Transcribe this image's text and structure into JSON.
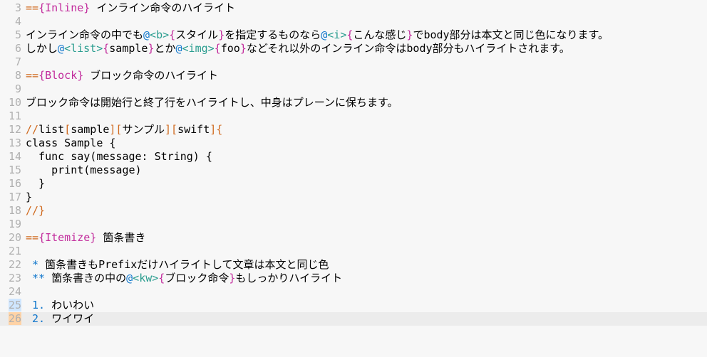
{
  "lines": {
    "3": {
      "n": "3",
      "seg": [
        [
          "or",
          "=="
        ],
        [
          "mag",
          "{Inline}"
        ],
        [
          "",
          " インライン命令のハイライト"
        ]
      ]
    },
    "4": {
      "n": "4",
      "seg": [
        [
          "",
          ""
        ]
      ]
    },
    "5": {
      "n": "5",
      "seg": [
        [
          "",
          "インライン命令の中でも"
        ],
        [
          "bl",
          "@"
        ],
        [
          "tag",
          "<b>"
        ],
        [
          "mag",
          "{"
        ],
        [
          "",
          "スタイル"
        ],
        [
          "mag",
          "}"
        ],
        [
          "",
          "を指定するものなら"
        ],
        [
          "bl",
          "@"
        ],
        [
          "tag",
          "<i>"
        ],
        [
          "mag",
          "{"
        ],
        [
          "",
          "こんな感じ"
        ],
        [
          "mag",
          "}"
        ],
        [
          "",
          "でbody部分は本文と同じ色になります。"
        ]
      ]
    },
    "6": {
      "n": "6",
      "seg": [
        [
          "",
          "しかし"
        ],
        [
          "bl",
          "@"
        ],
        [
          "tag",
          "<list>"
        ],
        [
          "mag",
          "{"
        ],
        [
          "",
          "sample"
        ],
        [
          "mag",
          "}"
        ],
        [
          "",
          "とか"
        ],
        [
          "bl",
          "@"
        ],
        [
          "tag",
          "<img>"
        ],
        [
          "mag",
          "{"
        ],
        [
          "",
          "foo"
        ],
        [
          "mag",
          "}"
        ],
        [
          "",
          "などそれ以外のインライン命令はbody部分もハイライトされます。"
        ]
      ]
    },
    "7": {
      "n": "7",
      "seg": [
        [
          "",
          ""
        ]
      ]
    },
    "8": {
      "n": "8",
      "seg": [
        [
          "or",
          "=="
        ],
        [
          "mag",
          "{Block}"
        ],
        [
          "",
          " ブロック命令のハイライト"
        ]
      ]
    },
    "9": {
      "n": "9",
      "seg": [
        [
          "",
          ""
        ]
      ]
    },
    "10": {
      "n": "10",
      "seg": [
        [
          "",
          "ブロック命令は開始行と終了行をハイライトし、中身はプレーンに保ちます。"
        ]
      ]
    },
    "11": {
      "n": "11",
      "seg": [
        [
          "",
          ""
        ]
      ]
    },
    "12": {
      "n": "12",
      "seg": [
        [
          "or",
          "//"
        ],
        [
          "",
          "list"
        ],
        [
          "or",
          "["
        ],
        [
          "",
          "sample"
        ],
        [
          "or",
          "]["
        ],
        [
          "",
          "サンプル"
        ],
        [
          "or",
          "]["
        ],
        [
          "",
          "swift"
        ],
        [
          "or",
          "]{"
        ]
      ]
    },
    "13": {
      "n": "13",
      "seg": [
        [
          "",
          "class Sample {"
        ]
      ]
    },
    "14": {
      "n": "14",
      "seg": [
        [
          "",
          "  func say(message: String) {"
        ]
      ]
    },
    "15": {
      "n": "15",
      "seg": [
        [
          "",
          "    print(message)"
        ]
      ]
    },
    "16": {
      "n": "16",
      "seg": [
        [
          "",
          "  }"
        ]
      ]
    },
    "17": {
      "n": "17",
      "seg": [
        [
          "",
          "}"
        ]
      ]
    },
    "18": {
      "n": "18",
      "seg": [
        [
          "or",
          "//}"
        ]
      ]
    },
    "19": {
      "n": "19",
      "seg": [
        [
          "",
          ""
        ]
      ]
    },
    "20": {
      "n": "20",
      "seg": [
        [
          "or",
          "=="
        ],
        [
          "mag",
          "{Itemize}"
        ],
        [
          "",
          " 箇条書き"
        ]
      ]
    },
    "21": {
      "n": "21",
      "seg": [
        [
          "",
          ""
        ]
      ]
    },
    "22": {
      "n": "22",
      "seg": [
        [
          "",
          " "
        ],
        [
          "bl",
          "*"
        ],
        [
          "",
          " 箇条書きもPrefixだけハイライトして文章は本文と同じ色"
        ]
      ]
    },
    "23": {
      "n": "23",
      "seg": [
        [
          "",
          " "
        ],
        [
          "bl",
          "**"
        ],
        [
          "",
          " 箇条書きの中の"
        ],
        [
          "bl",
          "@"
        ],
        [
          "tag",
          "<kw>"
        ],
        [
          "mag",
          "{"
        ],
        [
          "",
          "ブロック命令"
        ],
        [
          "mag",
          "}"
        ],
        [
          "",
          "もしっかりハイライト"
        ]
      ]
    },
    "24": {
      "n": "24",
      "seg": [
        [
          "",
          ""
        ]
      ]
    },
    "25": {
      "n": "25",
      "seg": [
        [
          "",
          " "
        ],
        [
          "bl",
          "1."
        ],
        [
          "",
          " わいわい"
        ]
      ]
    },
    "26": {
      "n": "26",
      "seg": [
        [
          "",
          " "
        ],
        [
          "bl",
          "2."
        ],
        [
          "",
          " ワイワイ"
        ]
      ],
      "current": true
    }
  },
  "order": [
    "3",
    "4",
    "5",
    "6",
    "7",
    "8",
    "9",
    "10",
    "11",
    "12",
    "13",
    "14",
    "15",
    "16",
    "17",
    "18",
    "19",
    "20",
    "21",
    "22",
    "23",
    "24",
    "25",
    "26"
  ],
  "gutter_highlight": {
    "25": "bluebg",
    "26": "orangebg"
  }
}
